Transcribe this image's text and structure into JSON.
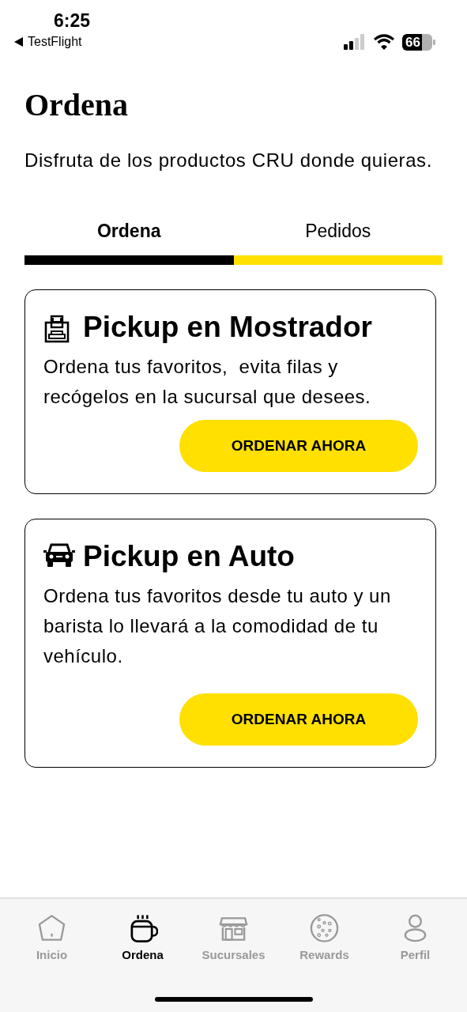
{
  "status_bar": {
    "time": "6:25",
    "back_app": "TestFlight",
    "battery": "66"
  },
  "title": "Ordena",
  "subtitle": "Disfruta de los productos CRU donde quieras.",
  "tabs": [
    {
      "label": "Ordena",
      "selected": true
    },
    {
      "label": "Pedidos",
      "selected": false
    }
  ],
  "cards": [
    {
      "kind": "counter",
      "title": "Pickup en Mostrador",
      "description": "Ordena tus favoritos,  evita filas y recógelos en la sucursal que desees.",
      "button": "ORDENAR AHORA"
    },
    {
      "kind": "car",
      "title": "Pickup en Auto",
      "description": "Ordena tus favoritos desde tu auto y un barista lo llevará a la comodidad de tu vehículo.",
      "button": "ORDENAR AHORA"
    }
  ],
  "nav": [
    {
      "kind": "home",
      "label": "Inicio",
      "selected": false
    },
    {
      "kind": "cup",
      "label": "Ordena",
      "selected": true
    },
    {
      "kind": "store",
      "label": "Sucursales",
      "selected": false
    },
    {
      "kind": "cookie",
      "label": "Rewards",
      "selected": false
    },
    {
      "kind": "person",
      "label": "Perfil",
      "selected": false
    }
  ]
}
